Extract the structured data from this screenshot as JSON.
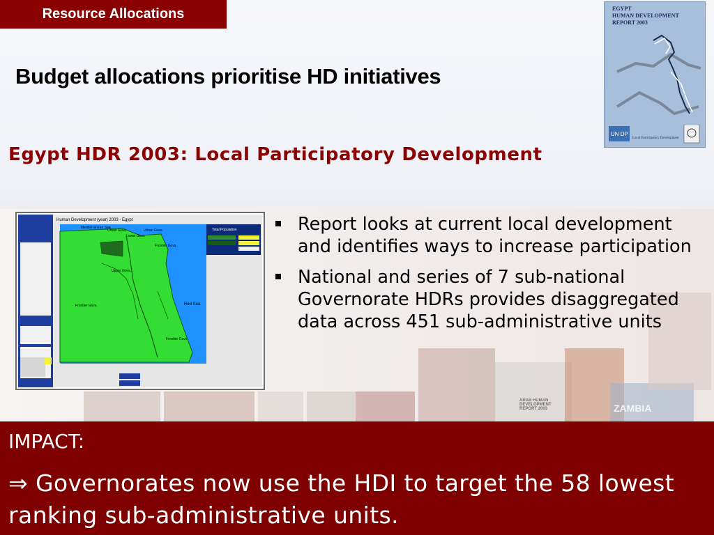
{
  "slide": {
    "section_tab": "Resource Allocations",
    "title": "Budget allocations prioritise HD initiatives",
    "subtitle": "Egypt HDR 2003: Local Participatory Development"
  },
  "cover": {
    "line1": "EGYPT",
    "line2": "HUMAN DEVELOPMENT",
    "line3": "REPORT 2003",
    "caption": "Local Participatory Development"
  },
  "map": {
    "header": "Human Development (year) 2003 - Egypt",
    "regions": {
      "sea_north": "Mediterranean Sea",
      "urban": "Urban Govs",
      "lower": "Lower Govs",
      "urban_east": "Urban Govs",
      "frontier_ne": "Frontier Govs.",
      "upper": "Upper Govs.",
      "frontier_west": "Frontier Govs.",
      "red_sea": "Red Sea",
      "frontier_se": "Frontier Govs."
    },
    "legend_title": "Total Population"
  },
  "bullets": [
    {
      "text": "Report looks at current local development and identifies ways to increase participation"
    },
    {
      "text": "National and series of 7 sub-national Governorate HDRs provides disaggregated data across 451 sub-administrative units"
    }
  ],
  "impact": {
    "label": "IMPACT:",
    "arrow": "⇒",
    "text": "Governorates now use the HDI to target the 58 lowest ranking sub-administrative units."
  },
  "collage": {
    "items": [
      "ZAMBIA",
      "ARAB HUMAN DEVELOPMENT REPORT 2003"
    ]
  },
  "colors": {
    "accent": "#8b0000",
    "impact_bg": "#7f0000",
    "map_land": "#33dd33",
    "map_sea": "#1e90ff"
  }
}
